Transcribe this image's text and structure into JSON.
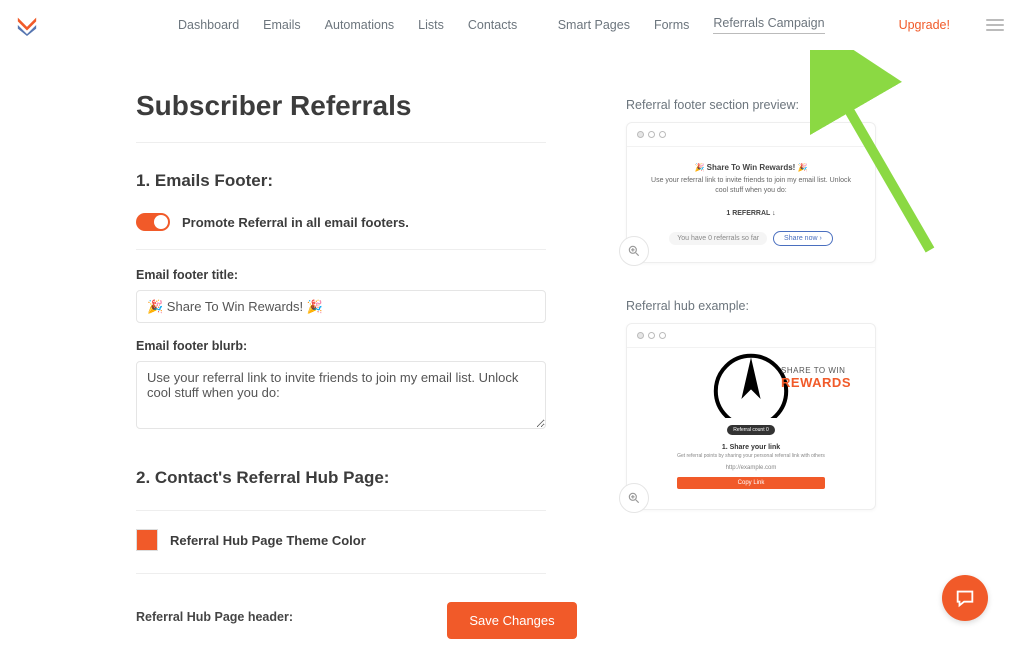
{
  "nav": {
    "left": [
      "Dashboard",
      "Emails",
      "Automations",
      "Lists",
      "Contacts"
    ],
    "right": [
      "Smart Pages",
      "Forms",
      "Referrals Campaign"
    ],
    "upgrade": "Upgrade!"
  },
  "page": {
    "title": "Subscriber Referrals",
    "section1": {
      "heading": "1. Emails Footer:",
      "toggle_label": "Promote Referral in all email footers.",
      "footer_title_label": "Email footer title:",
      "footer_title_value": "🎉 Share To Win Rewards! 🎉",
      "footer_blurb_label": "Email footer blurb:",
      "footer_blurb_value": "Use your referral link to invite friends to join my email list. Unlock cool stuff when you do:"
    },
    "section2": {
      "heading": "2. Contact's Referral Hub Page:",
      "color_label": "Referral Hub Page Theme Color",
      "truncated_label": "Referral Hub Page header:"
    }
  },
  "preview_footer": {
    "label": "Referral footer section preview:",
    "title": "🎉 Share To Win Rewards! 🎉",
    "blurb": "Use your referral link to invite friends to join my email list. Unlock cool stuff when you do:",
    "referral_text": "1 REFERRAL ↓",
    "count_text": "You have 0 referrals so far",
    "share_text": "Share now ›"
  },
  "preview_hub": {
    "label": "Referral hub example:",
    "share_line1": "SHARE TO WIN",
    "share_line2": "REWARDS",
    "badge": "Referral count 0",
    "step_heading": "1. Share your link",
    "step_text": "Get referral points by sharing your personal referral link with others",
    "url": "http://example.com",
    "copy": "Copy Link"
  },
  "actions": {
    "save": "Save Changes"
  },
  "colors": {
    "accent": "#f15a29"
  }
}
